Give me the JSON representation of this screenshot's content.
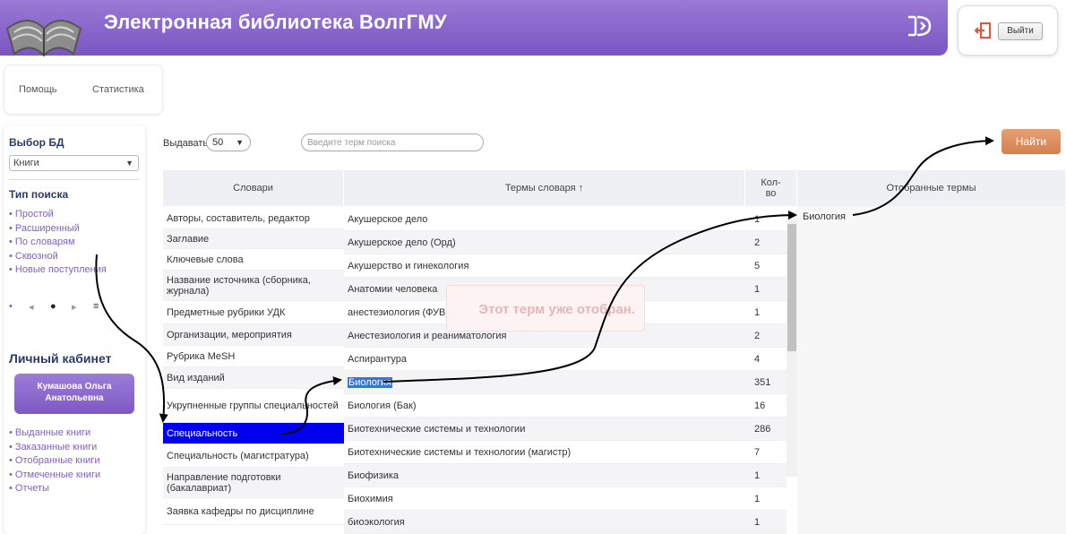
{
  "header": {
    "title": "Электронная библиотека ВолгГМУ",
    "logo_icon": "open-book-icon",
    "right_icon": "logout-arrow-icon",
    "exit_label": "Выйти"
  },
  "topnav": [
    "Помощь",
    "Статистика"
  ],
  "sidebar": {
    "db_heading": "Выбор БД",
    "db_value": "Книги",
    "search_type_heading": "Тип поиска",
    "search_types": [
      "Простой",
      "Расширенный",
      "По словарям",
      "Сквозной",
      "Новые поступления"
    ],
    "pager": [
      "•",
      "◂",
      "●",
      "▸",
      "≡"
    ],
    "cabinet_heading": "Личный кабинет",
    "user_name": "Кумашова Ольга Анатольевна",
    "cabinet_links": [
      "Выданные книги",
      "Заказанные книги",
      "Отобранные книги",
      "Отмеченные книги",
      "Отчеты"
    ]
  },
  "controls": {
    "per_page_label": "Выдавать по:",
    "per_page_value": "50",
    "search_placeholder": "Введите терм поиска",
    "find_label": "Найти"
  },
  "table": {
    "headers": {
      "dictionaries": "Словари",
      "terms": "Термы словаря ↑",
      "count": "Кол-во",
      "chosen": "Отобранные термы"
    },
    "dictionaries": [
      "Авторы, составитель, редактор",
      "Заглавие",
      "Ключевые слова",
      "Название источника (сборника, журнала)",
      "Предметные рубрики УДК",
      "Организации, мероприятия",
      "Рубрика MeSH",
      "Вид изданий",
      "Укрупненные группы специальностей",
      "Специальность",
      "Специальность (магистратура)",
      "Направление подготовки (бакалавриат)",
      "Заявка кафедры по дисциплине"
    ],
    "selected_dictionary": "Специальность",
    "terms": [
      {
        "term": "Акушерское дело",
        "count": "1"
      },
      {
        "term": "Акушерское дело (Орд)",
        "count": "2"
      },
      {
        "term": "Акушерство и гинекология",
        "count": "5"
      },
      {
        "term": "Анатомии человека",
        "count": "1"
      },
      {
        "term": "анестезиология (ФУВ)",
        "count": "1"
      },
      {
        "term": "Анестезиология и реаниматология",
        "count": "2"
      },
      {
        "term": "Аспирантура",
        "count": "4"
      },
      {
        "term": "Биология",
        "count": "351"
      },
      {
        "term": "Биология (Бак)",
        "count": "16"
      },
      {
        "term": "Биотехнические системы и технологии",
        "count": "286"
      },
      {
        "term": "Биотехнические системы и технологии (магистр)",
        "count": "7"
      },
      {
        "term": "Биофизика",
        "count": "1"
      },
      {
        "term": "Биохимия",
        "count": "1"
      },
      {
        "term": "биоэкология",
        "count": "1"
      }
    ],
    "highlighted_term": "Биология",
    "chosen_terms": [
      "Биология"
    ],
    "ghost_message": "Этот терм уже отобран."
  },
  "colors": {
    "header": "#8766cc",
    "accent": "#7f5fc6",
    "selected_row": "#0000ee",
    "find_button": "#dc8b5a"
  }
}
